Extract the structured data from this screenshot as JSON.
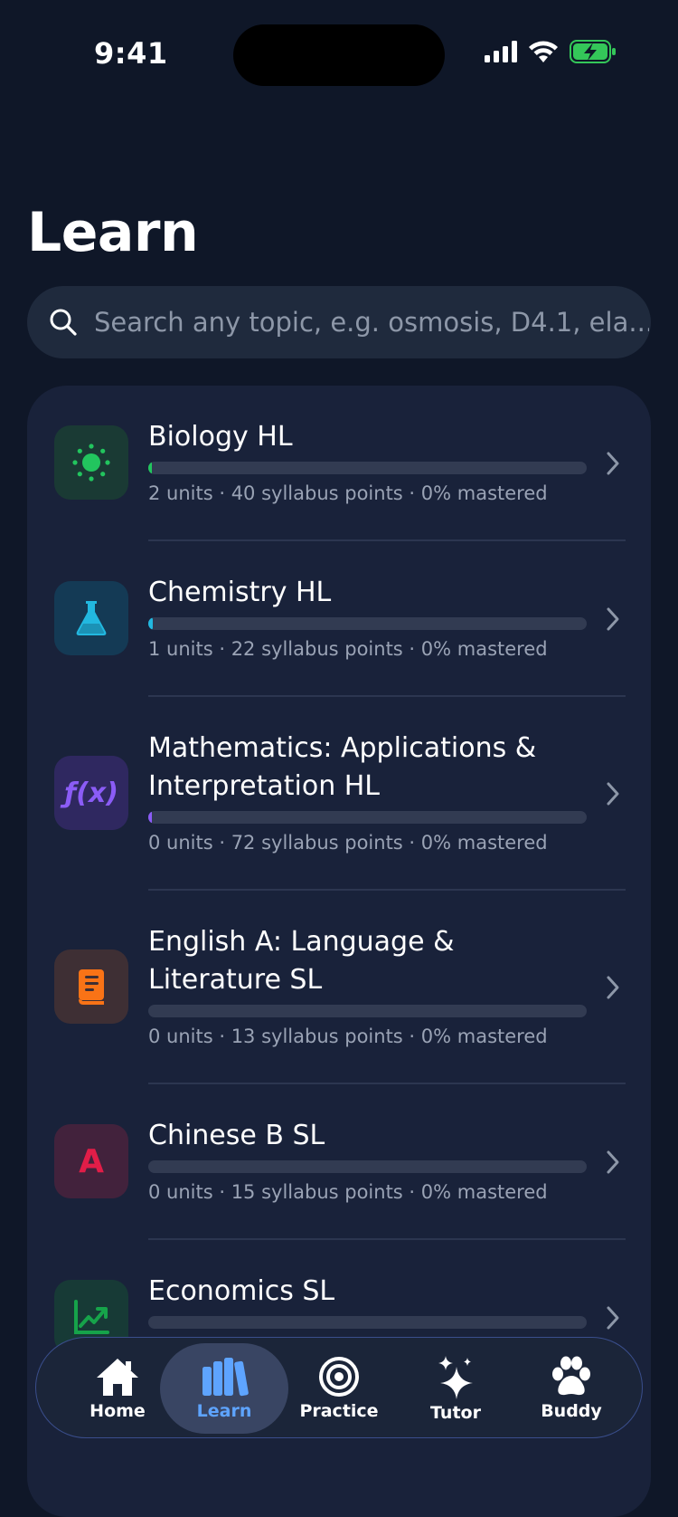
{
  "status_bar": {
    "time": "9:41"
  },
  "page": {
    "title": "Learn"
  },
  "search": {
    "placeholder": "Search any topic, e.g. osmosis, D4.1, ela..."
  },
  "colors": {
    "background": "#0f1728",
    "card": "#19223a",
    "accent_blue": "#5ea4ff",
    "biology": "#22c55e",
    "chemistry": "#22b8e0",
    "math": "#8b5cf6",
    "english": "#f97316",
    "chinese": "#e11d48",
    "economics": "#16a34a"
  },
  "subjects": [
    {
      "title": "Biology HL",
      "meta": "2 units · 40 syllabus points · 0% mastered",
      "icon": "sun-icon",
      "progress": 0.005
    },
    {
      "title": "Chemistry HL",
      "meta": "1 units · 22 syllabus points · 0% mastered",
      "icon": "flask-icon",
      "progress": 0.01
    },
    {
      "title": "Mathematics: Applications & Interpretation HL",
      "meta": "0 units · 72 syllabus points · 0% mastered",
      "icon": "function-icon",
      "icon_text": "ƒ(x)",
      "progress": 0.005
    },
    {
      "title": "English A: Language & Literature SL",
      "meta": "0 units · 13 syllabus points · 0% mastered",
      "icon": "book-icon",
      "progress": 0
    },
    {
      "title": "Chinese B SL",
      "meta": "0 units · 15 syllabus points · 0% mastered",
      "icon": "letter-a-icon",
      "icon_text": "A",
      "progress": 0
    },
    {
      "title": "Economics SL",
      "meta": "",
      "icon": "chart-trend-icon",
      "progress": 0
    }
  ],
  "tabbar": {
    "tabs": [
      {
        "label": "Home",
        "icon": "house-icon"
      },
      {
        "label": "Learn",
        "icon": "books-icon",
        "active": true
      },
      {
        "label": "Practice",
        "icon": "target-icon"
      },
      {
        "label": "Tutor",
        "icon": "sparkles-icon"
      },
      {
        "label": "Buddy",
        "icon": "paw-icon"
      }
    ]
  }
}
